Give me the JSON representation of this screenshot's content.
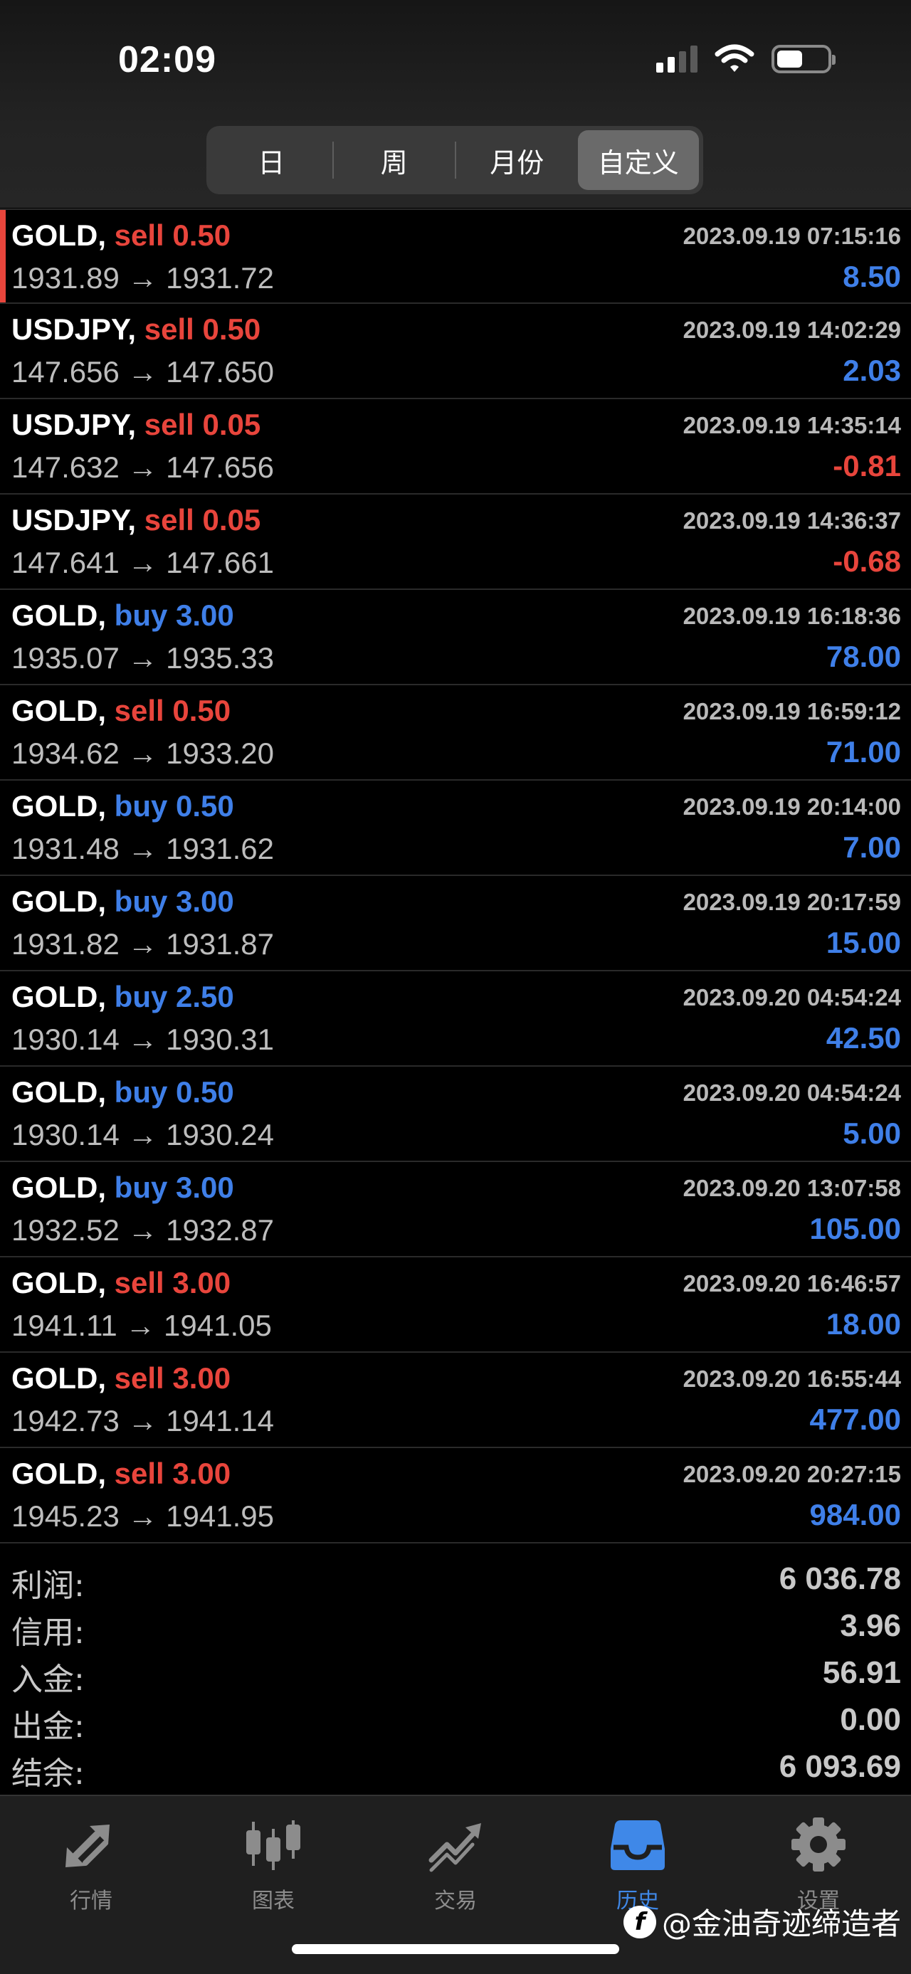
{
  "status": {
    "time": "02:09"
  },
  "segments": [
    {
      "label": "日",
      "selected": false
    },
    {
      "label": "周",
      "selected": false
    },
    {
      "label": "月份",
      "selected": false
    },
    {
      "label": "自定义",
      "selected": true
    }
  ],
  "trades": [
    {
      "symbol": "GOLD,",
      "side": "sell",
      "lots": "sell 0.50",
      "datetime": "2023.09.19 07:15:16",
      "prices": "1931.89 → 1931.72",
      "profit": "8.50"
    },
    {
      "symbol": "USDJPY,",
      "side": "sell",
      "lots": "sell 0.50",
      "datetime": "2023.09.19 14:02:29",
      "prices": "147.656 → 147.650",
      "profit": "2.03"
    },
    {
      "symbol": "USDJPY,",
      "side": "sell",
      "lots": "sell 0.05",
      "datetime": "2023.09.19 14:35:14",
      "prices": "147.632 → 147.656",
      "profit": "-0.81"
    },
    {
      "symbol": "USDJPY,",
      "side": "sell",
      "lots": "sell 0.05",
      "datetime": "2023.09.19 14:36:37",
      "prices": "147.641 → 147.661",
      "profit": "-0.68"
    },
    {
      "symbol": "GOLD,",
      "side": "buy",
      "lots": "buy 3.00",
      "datetime": "2023.09.19 16:18:36",
      "prices": "1935.07 → 1935.33",
      "profit": "78.00"
    },
    {
      "symbol": "GOLD,",
      "side": "sell",
      "lots": "sell 0.50",
      "datetime": "2023.09.19 16:59:12",
      "prices": "1934.62 → 1933.20",
      "profit": "71.00"
    },
    {
      "symbol": "GOLD,",
      "side": "buy",
      "lots": "buy 0.50",
      "datetime": "2023.09.19 20:14:00",
      "prices": "1931.48 → 1931.62",
      "profit": "7.00"
    },
    {
      "symbol": "GOLD,",
      "side": "buy",
      "lots": "buy 3.00",
      "datetime": "2023.09.19 20:17:59",
      "prices": "1931.82 → 1931.87",
      "profit": "15.00"
    },
    {
      "symbol": "GOLD,",
      "side": "buy",
      "lots": "buy 2.50",
      "datetime": "2023.09.20 04:54:24",
      "prices": "1930.14 → 1930.31",
      "profit": "42.50"
    },
    {
      "symbol": "GOLD,",
      "side": "buy",
      "lots": "buy 0.50",
      "datetime": "2023.09.20 04:54:24",
      "prices": "1930.14 → 1930.24",
      "profit": "5.00"
    },
    {
      "symbol": "GOLD,",
      "side": "buy",
      "lots": "buy 3.00",
      "datetime": "2023.09.20 13:07:58",
      "prices": "1932.52 → 1932.87",
      "profit": "105.00"
    },
    {
      "symbol": "GOLD,",
      "side": "sell",
      "lots": "sell 3.00",
      "datetime": "2023.09.20 16:46:57",
      "prices": "1941.11 → 1941.05",
      "profit": "18.00"
    },
    {
      "symbol": "GOLD,",
      "side": "sell",
      "lots": "sell 3.00",
      "datetime": "2023.09.20 16:55:44",
      "prices": "1942.73 → 1941.14",
      "profit": "477.00"
    },
    {
      "symbol": "GOLD,",
      "side": "sell",
      "lots": "sell 3.00",
      "datetime": "2023.09.20 20:27:15",
      "prices": "1945.23 → 1941.95",
      "profit": "984.00"
    }
  ],
  "summary": [
    {
      "label": "利润:",
      "value": "6 036.78"
    },
    {
      "label": "信用:",
      "value": "3.96"
    },
    {
      "label": "入金:",
      "value": "56.91"
    },
    {
      "label": "出金:",
      "value": "0.00"
    },
    {
      "label": "结余:",
      "value": "6 093.69"
    }
  ],
  "tabs": [
    {
      "label": "行情",
      "icon": "quotes-arrows-icon",
      "selected": false
    },
    {
      "label": "图表",
      "icon": "candlestick-chart-icon",
      "selected": false
    },
    {
      "label": "交易",
      "icon": "trade-trend-icon",
      "selected": false
    },
    {
      "label": "历史",
      "icon": "history-inbox-icon",
      "selected": true
    },
    {
      "label": "设置",
      "icon": "gear-icon",
      "selected": false
    }
  ],
  "watermark": "@金油奇迹缔造者",
  "colors": {
    "sell": "#e8453c",
    "buy": "#3f7fe8",
    "selected_tab": "#3f88e8"
  }
}
